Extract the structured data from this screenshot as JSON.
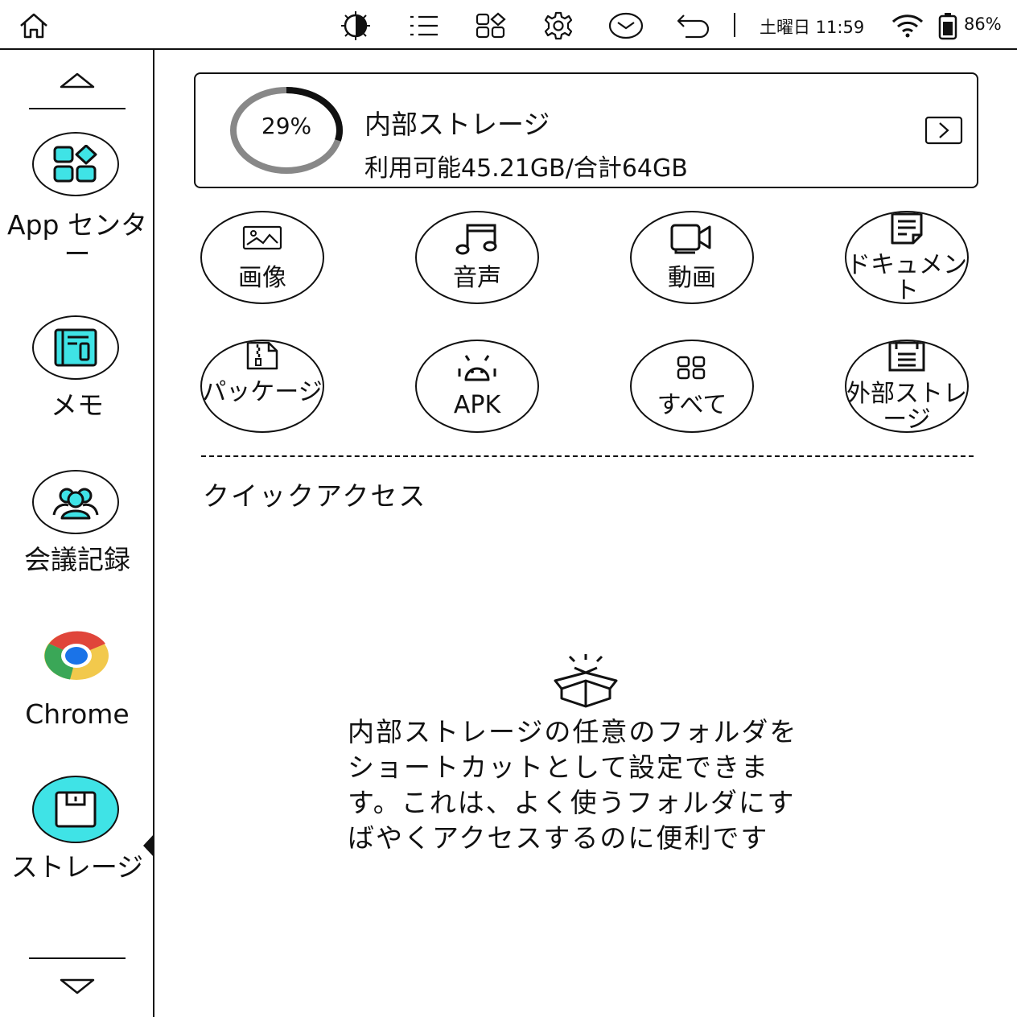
{
  "status_bar": {
    "icons": [
      "home-icon",
      "contrast-icon",
      "list-icon",
      "apps-icon",
      "gear-icon",
      "mail-icon",
      "back-icon",
      "wifi-icon",
      "battery-icon"
    ],
    "datetime": "土曜日 11:59",
    "battery": "86%"
  },
  "sidebar": {
    "items": [
      {
        "label": "App センター",
        "icon": "apps-icon"
      },
      {
        "label": "メモ",
        "icon": "memo-icon"
      },
      {
        "label": "会議記録",
        "icon": "people-icon"
      },
      {
        "label": "Chrome",
        "icon": "chrome-icon"
      },
      {
        "label": "ストレージ",
        "icon": "storage-icon",
        "active": true
      }
    ]
  },
  "storage": {
    "percent_label": "29%",
    "used_fraction": 0.29,
    "title": "内部ストレージ",
    "subtitle": "利用可能45.21GB/合計64GB"
  },
  "categories": [
    {
      "label": "画像",
      "icon": "image-icon"
    },
    {
      "label": "音声",
      "icon": "music-icon"
    },
    {
      "label": "動画",
      "icon": "video-icon"
    },
    {
      "label": "ドキュメント",
      "icon": "document-icon"
    },
    {
      "label": "パッケージ",
      "icon": "zip-icon"
    },
    {
      "label": "APK",
      "icon": "android-icon"
    },
    {
      "label": "すべて",
      "icon": "grid-icon"
    },
    {
      "label": "外部ストレージ",
      "icon": "external-storage-icon"
    }
  ],
  "quick_access": {
    "title": "クイックアクセス",
    "empty_message": "内部ストレージの任意のフォルダをショートカットとして設定できます。これは、よく使うフォルダにすばやくアクセスするのに便利です"
  },
  "colors": {
    "accent": "#3fe3e6",
    "ring_used": "#111111",
    "ring_free": "#888888"
  }
}
